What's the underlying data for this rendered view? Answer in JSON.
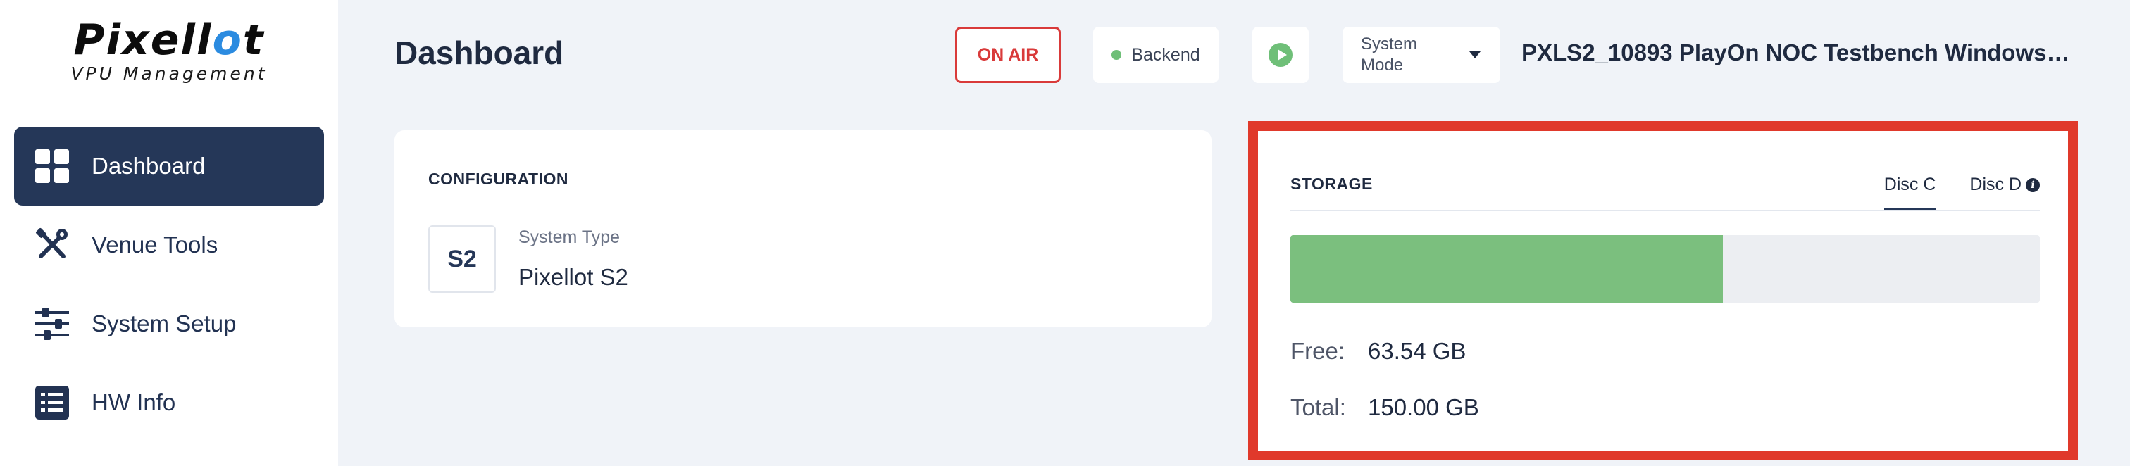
{
  "brand": {
    "name_a": "Pixell",
    "name_b": "o",
    "name_c": "t",
    "subtitle": "VPU Management"
  },
  "sidebar": {
    "items": [
      {
        "label": "Dashboard",
        "icon": "grid-icon",
        "active": true
      },
      {
        "label": "Venue Tools",
        "icon": "tools-icon",
        "active": false
      },
      {
        "label": "System Setup",
        "icon": "sliders-icon",
        "active": false
      },
      {
        "label": "HW Info",
        "icon": "list-icon",
        "active": false
      }
    ]
  },
  "header": {
    "title": "Dashboard",
    "on_air": "ON AIR",
    "backend": "Backend",
    "system_mode": "System Mode",
    "device_name": "PXLS2_10893 PlayOn NOC Testbench Windows_I..."
  },
  "configuration": {
    "title": "CONFIGURATION",
    "badge": "S2",
    "system_type_label": "System Type",
    "system_type_value": "Pixellot S2"
  },
  "storage": {
    "title": "STORAGE",
    "tabs": [
      {
        "label": "Disc C",
        "active": true
      },
      {
        "label": "Disc D",
        "active": false
      }
    ],
    "used_fraction": 0.577,
    "free_label": "Free:",
    "free_value": "63.54 GB",
    "total_label": "Total:",
    "total_value": "150.00 GB"
  },
  "colors": {
    "sidebar_active": "#253758",
    "on_air": "#d93a3a",
    "status_green": "#6fbf78",
    "storage_fill": "#7bbf7e",
    "highlight": "#e0392b"
  }
}
